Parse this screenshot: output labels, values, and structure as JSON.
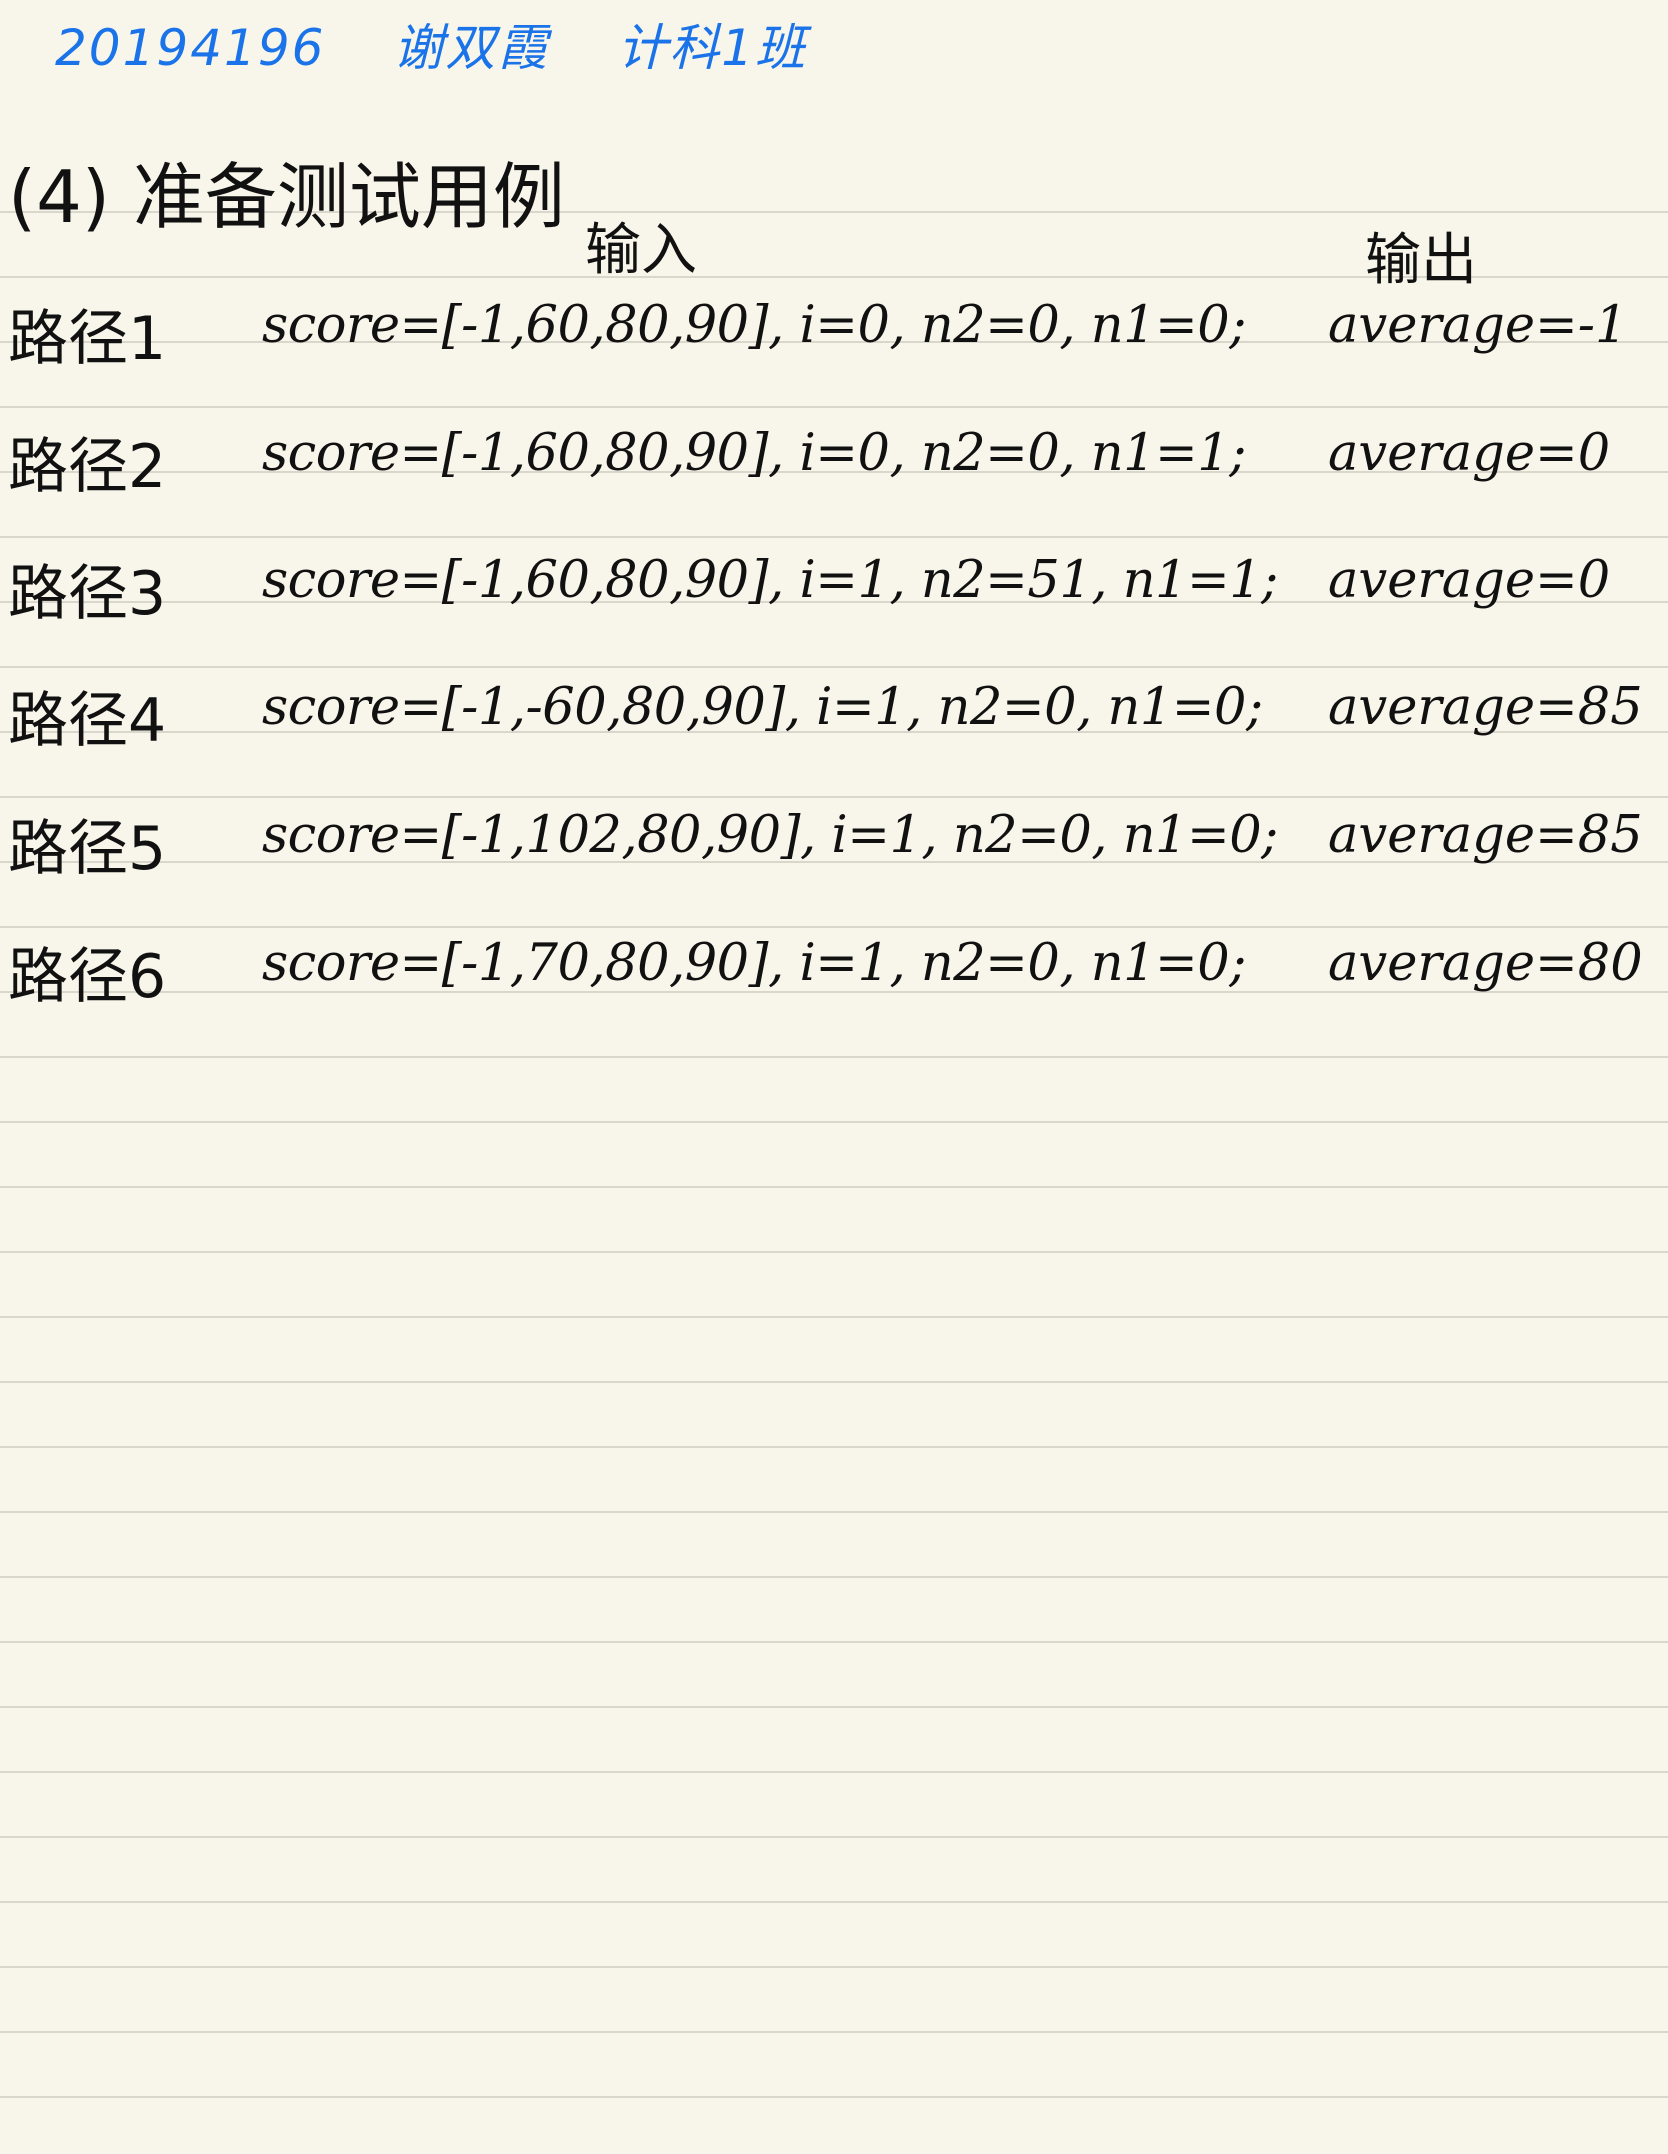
{
  "header": {
    "student_id": "20194196",
    "name": "谢双霞",
    "class": "计科1班"
  },
  "section": {
    "title": "(4) 准备测试用例"
  },
  "columns": {
    "input": "输入",
    "output": "输出"
  },
  "rows": [
    {
      "label": "路径1",
      "input": "score=[-1,60,80,90], i=0, n2=0, n1=0;",
      "output": "average=-1"
    },
    {
      "label": "路径2",
      "input": "score=[-1,60,80,90], i=0, n2=0, n1=1;",
      "output": "average=0"
    },
    {
      "label": "路径3",
      "input": "score=[-1,60,80,90], i=1, n2=51, n1=1;",
      "output": "average=0"
    },
    {
      "label": "路径4",
      "input": "score=[-1,-60,80,90], i=1, n2=0, n1=0;",
      "output": "average=85"
    },
    {
      "label": "路径5",
      "input": "score=[-1,102,80,90], i=1, n2=0, n1=0;",
      "output": "average=85"
    },
    {
      "label": "路径6",
      "input": "score=[-1,70,80,90], i=1, n2=0, n1=0;",
      "output": "average=80"
    }
  ]
}
